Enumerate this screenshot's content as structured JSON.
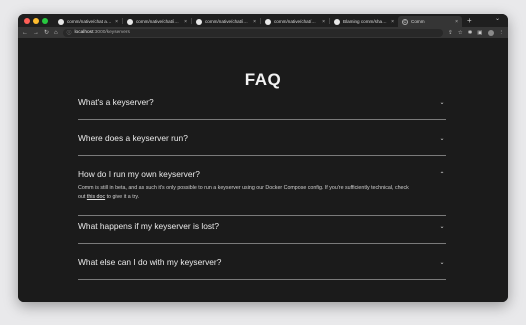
{
  "browser": {
    "tabs": [
      {
        "title": "comm/native/chat at mast",
        "favicon": "github-icon",
        "active": false
      },
      {
        "title": "comm/native/chat/inline-",
        "favicon": "github-icon",
        "active": false
      },
      {
        "title": "comm/native/chat/inner-te",
        "favicon": "github-icon",
        "active": false
      },
      {
        "title": "comm/native/chat/multime",
        "favicon": "github-icon",
        "active": false
      },
      {
        "title": "Blaming comm/shared/sear",
        "favicon": "github-icon",
        "active": false
      },
      {
        "title": "Comm",
        "favicon": "comm-icon",
        "active": true
      }
    ],
    "url_host": "localhost",
    "url_path": ":3000/keyservers",
    "new_tab_glyph": "+",
    "colors": {
      "tabstrip": "#1f1f1f",
      "toolbar": "#353535",
      "content": "#1b1b1b"
    }
  },
  "page": {
    "title": "FAQ",
    "items": [
      {
        "question": "What's a keyserver?",
        "expanded": false
      },
      {
        "question": "Where does a keyserver run?",
        "expanded": false
      },
      {
        "question": "How do I run my own keyserver?",
        "expanded": true,
        "answer_line1": "Comm is still in beta, and as such it's only possible to run a keyserver using our Docker Compose config. If you're sufficiently technical, check",
        "answer_pre": "out ",
        "answer_link": "this doc",
        "answer_post": " to give it a try."
      },
      {
        "question": "What happens if my keyserver is lost?",
        "expanded": false
      },
      {
        "question": "What else can I do with my keyserver?",
        "expanded": false
      }
    ]
  }
}
